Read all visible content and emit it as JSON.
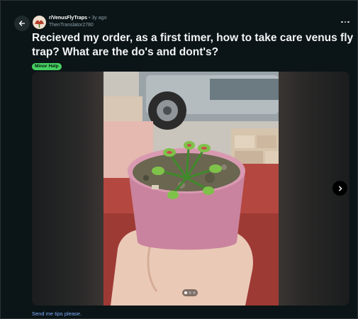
{
  "post": {
    "subreddit": "r/VenusFlyTraps",
    "separator": "•",
    "age": "3y ago",
    "author": "ThenTranslator2780",
    "title": "Recieved my order, as a first timer, how to take care venus fly trap? What are the do's and dont's?",
    "flair": "Minor Help",
    "body": "Send me tips please.",
    "gallery": {
      "current": 1,
      "total": 3
    }
  },
  "icons": {
    "back": "arrow-left-icon",
    "more": "more-horizontal-icon",
    "next": "chevron-right-icon"
  },
  "colors": {
    "background": "#0b1416",
    "flair_bg": "#46d160",
    "link": "#7eaeff",
    "meta": "#8ba2ad"
  }
}
